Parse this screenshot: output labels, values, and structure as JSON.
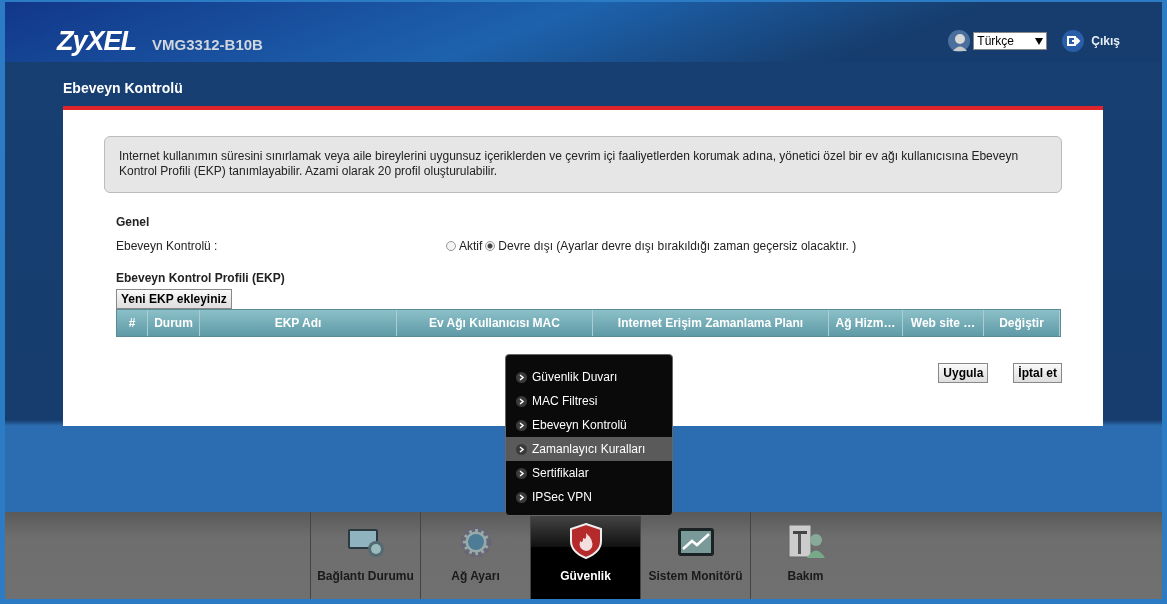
{
  "header": {
    "logo": "ZyXEL",
    "model": "VMG3312-B10B",
    "language": "Türkçe",
    "logout": "Çıkış"
  },
  "page_title": "Ebeveyn Kontrolü",
  "info": "Internet kullanımın süresini sınırlamak veya aile bireylerini uygunsuz içeriklerden ve çevrim içi faaliyetlerden korumak adına, yönetici özel bir ev ağı kullanıcısına Ebeveyn Kontrol Profili (EKP) tanımlayabilir. Azami olarak 20 profil oluşturulabilir.",
  "general": {
    "heading": "Genel",
    "label": "Ebeveyn Kontrolü :",
    "options": [
      {
        "label": "Aktif",
        "selected": false
      },
      {
        "label": "Devre dışı (Ayarlar devre dışı bırakıldığı zaman geçersiz olacaktır. )",
        "selected": true
      }
    ]
  },
  "profiles": {
    "heading": "Ebeveyn Kontrol Profili (EKP)",
    "add_button": "Yeni EKP ekleyiniz",
    "columns": [
      "#",
      "Durum",
      "EKP Adı",
      "Ev Ağı Kullanıcısı MAC",
      "Internet Erişim Zamanlama Planı",
      "Ağ Hizm…",
      "Web site …",
      "Değiştir"
    ]
  },
  "buttons": [
    "Uygula",
    "İptal et"
  ],
  "menu": [
    {
      "label": "Güvenlik Duvarı",
      "selected": false
    },
    {
      "label": "MAC Filtresi",
      "selected": false
    },
    {
      "label": "Ebeveyn Kontrolü",
      "selected": false
    },
    {
      "label": "Zamanlayıcı Kuralları",
      "selected": true
    },
    {
      "label": "Sertifikalar",
      "selected": false
    },
    {
      "label": "IPSec VPN",
      "selected": false
    }
  ],
  "nav": [
    {
      "label": "Bağlantı Durumu",
      "kind": "monitor",
      "selected": false
    },
    {
      "label": "Ağ Ayarı",
      "kind": "gear",
      "selected": false
    },
    {
      "label": "Güvenlik",
      "kind": "shield",
      "selected": true
    },
    {
      "label": "Sistem Monitörü",
      "kind": "chart",
      "selected": false
    },
    {
      "label": "Bakım",
      "kind": "tools",
      "selected": false
    }
  ]
}
